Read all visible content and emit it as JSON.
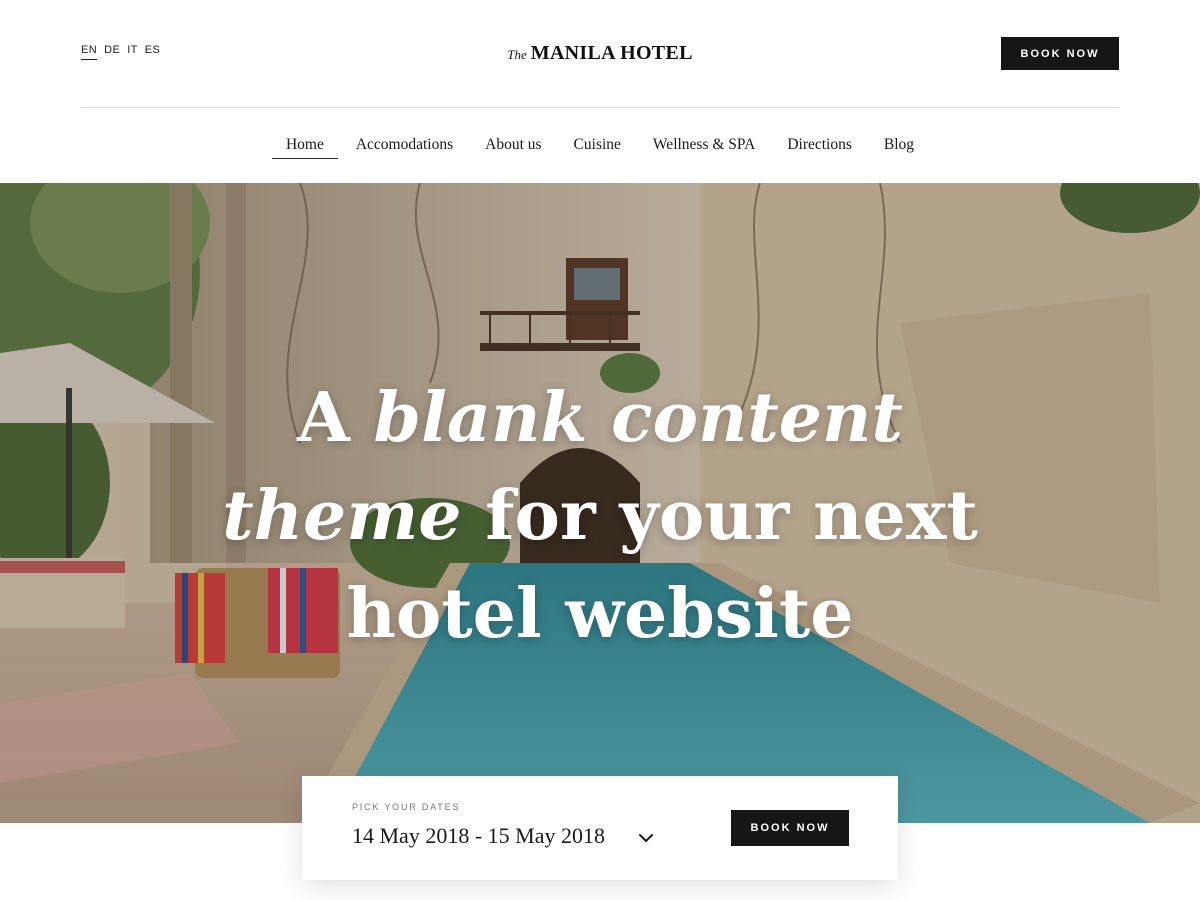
{
  "header": {
    "languages": [
      {
        "code": "EN",
        "active": true
      },
      {
        "code": "DE",
        "active": false
      },
      {
        "code": "IT",
        "active": false
      },
      {
        "code": "ES",
        "active": false
      }
    ],
    "logo_prefix": "The",
    "logo_name": "MANILA HOTEL",
    "book_now_label": "BOOK NOW"
  },
  "nav": {
    "items": [
      {
        "label": "Home",
        "active": true
      },
      {
        "label": "Accomodations",
        "active": false
      },
      {
        "label": "About us",
        "active": false
      },
      {
        "label": "Cuisine",
        "active": false
      },
      {
        "label": "Wellness & SPA",
        "active": false
      },
      {
        "label": "Directions",
        "active": false
      },
      {
        "label": "Blog",
        "active": false
      }
    ]
  },
  "hero": {
    "headline": {
      "line1_plain": "A ",
      "line1_em": "blank content",
      "line2_em": "theme",
      "line2_plain": " for your next",
      "line3_plain": "hotel website"
    }
  },
  "booking": {
    "label": "PICK YOUR DATES",
    "dates": "14 May 2018 - 15 May 2018",
    "book_now_label": "BOOK NOW"
  },
  "colors": {
    "button_bg": "#161616",
    "pool": "#3e9aa6",
    "wall": "#d8c8b0"
  },
  "icons": {
    "chevron": "chevron-down-icon"
  }
}
